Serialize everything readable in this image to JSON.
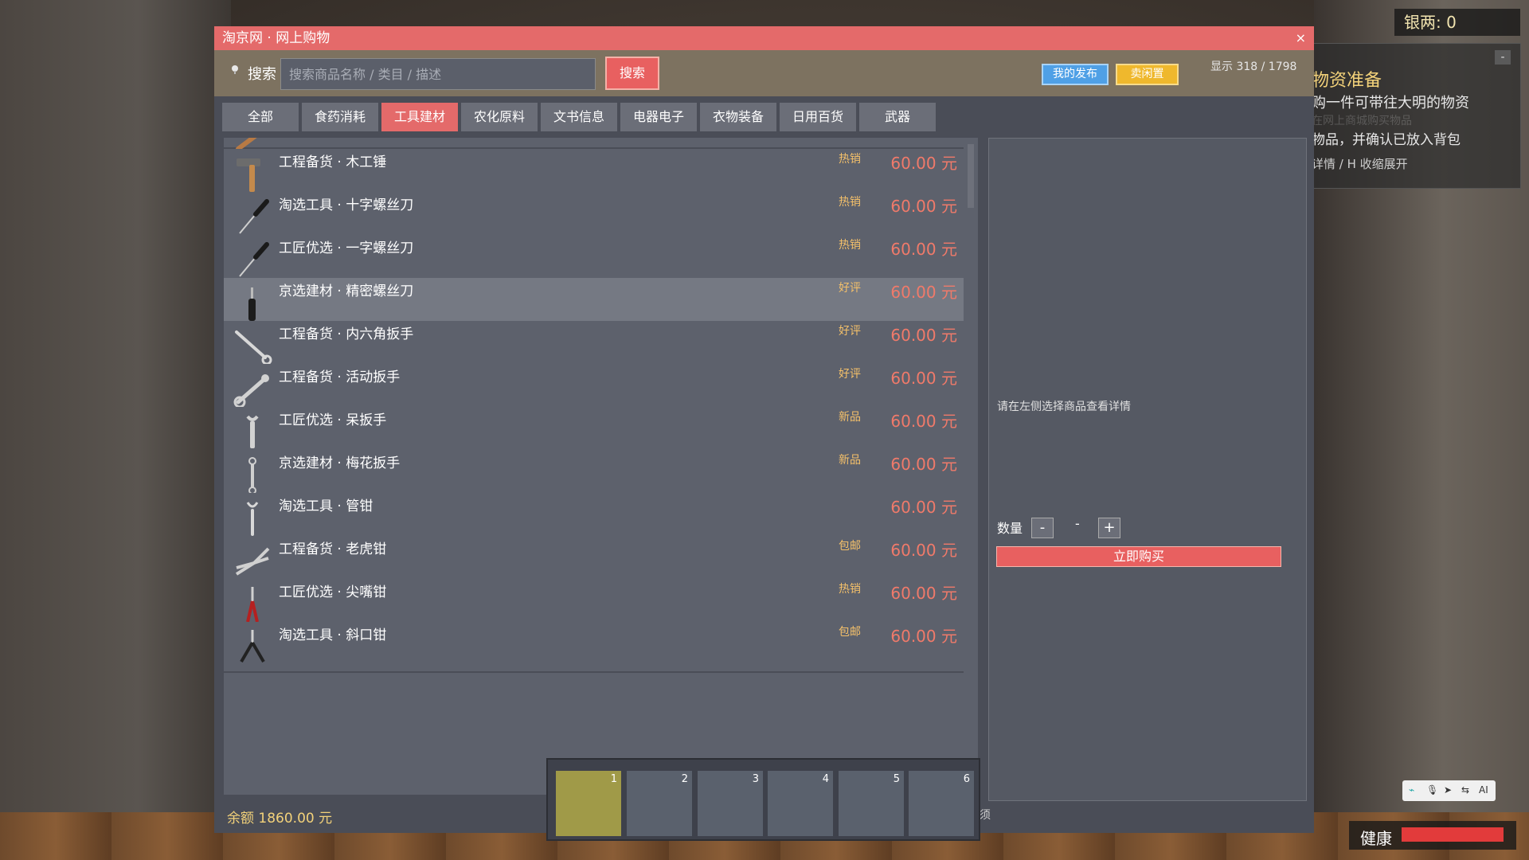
{
  "hud": {
    "silver": "银两: 0",
    "quest": {
      "title": "物资准备",
      "line1": "购一件可带往大明的物资",
      "ghost": "在网上商城购买物品",
      "line2": "物品，并确认已放入背包",
      "line3": "详情 / H 收缩展开",
      "min_label": "-"
    },
    "health_label": "健康",
    "health_value": 1.0
  },
  "window": {
    "title": "淘京网 · 网上购物",
    "close_label": "×"
  },
  "search": {
    "label": "搜索",
    "placeholder": "搜索商品名称 / 类目 / 描述",
    "button": "搜索",
    "my_posts": "我的发布",
    "sell_idle": "卖闲置",
    "display_count": "显示 318 / 1798"
  },
  "tabs": [
    "全部",
    "食药消耗",
    "工具建材",
    "农化原料",
    "文书信息",
    "电器电子",
    "衣物装备",
    "日用百货",
    "武器"
  ],
  "active_tab": "工具建材",
  "products": [
    {
      "name": "工程备货 · 木工锤",
      "badge": "热销",
      "price": "60.00 元",
      "icon": "hammer-icon"
    },
    {
      "name": "淘选工具 · 十字螺丝刀",
      "badge": "热销",
      "price": "60.00 元",
      "icon": "screwdriver-icon"
    },
    {
      "name": "工匠优选 · 一字螺丝刀",
      "badge": "热销",
      "price": "60.00 元",
      "icon": "screwdriver-icon"
    },
    {
      "name": "京选建材 · 精密螺丝刀",
      "badge": "好评",
      "price": "60.00 元",
      "icon": "precision-screwdriver-icon"
    },
    {
      "name": "工程备货 · 内六角扳手",
      "badge": "好评",
      "price": "60.00 元",
      "icon": "hex-key-icon"
    },
    {
      "name": "工程备货 · 活动扳手",
      "badge": "好评",
      "price": "60.00 元",
      "icon": "adjustable-wrench-icon"
    },
    {
      "name": "工匠优选 · 呆扳手",
      "badge": "新品",
      "price": "60.00 元",
      "icon": "open-wrench-icon"
    },
    {
      "name": "京选建材 · 梅花扳手",
      "badge": "新品",
      "price": "60.00 元",
      "icon": "box-wrench-icon"
    },
    {
      "name": "淘选工具 · 管钳",
      "badge": "",
      "price": "60.00 元",
      "icon": "pipe-wrench-icon"
    },
    {
      "name": "工程备货 · 老虎钳",
      "badge": "包邮",
      "price": "60.00 元",
      "icon": "pliers-icon"
    },
    {
      "name": "工匠优选 · 尖嘴钳",
      "badge": "热销",
      "price": "60.00 元",
      "icon": "needle-nose-pliers-icon"
    },
    {
      "name": "淘选工具 · 斜口钳",
      "badge": "包邮",
      "price": "60.00 元",
      "icon": "cutting-pliers-icon"
    }
  ],
  "detail": {
    "hint": "请在左侧选择商品查看详情",
    "qty_label": "数量",
    "qty_minus": "-",
    "qty_value": "-",
    "qty_plus": "+",
    "buy_label": "立即购买"
  },
  "footer": {
    "balance": "余额 1860.00 元",
    "partial": "须"
  },
  "hotbar": [
    "1",
    "2",
    "3",
    "4",
    "5",
    "6"
  ],
  "voice_bar": [
    "⌁",
    "🎙",
    "➤",
    "⇆",
    "AI"
  ],
  "colors": {
    "accent": "#e46a6a",
    "price": "#f07a6a",
    "badge": "#f4c06a",
    "balance": "#f3d27a"
  }
}
